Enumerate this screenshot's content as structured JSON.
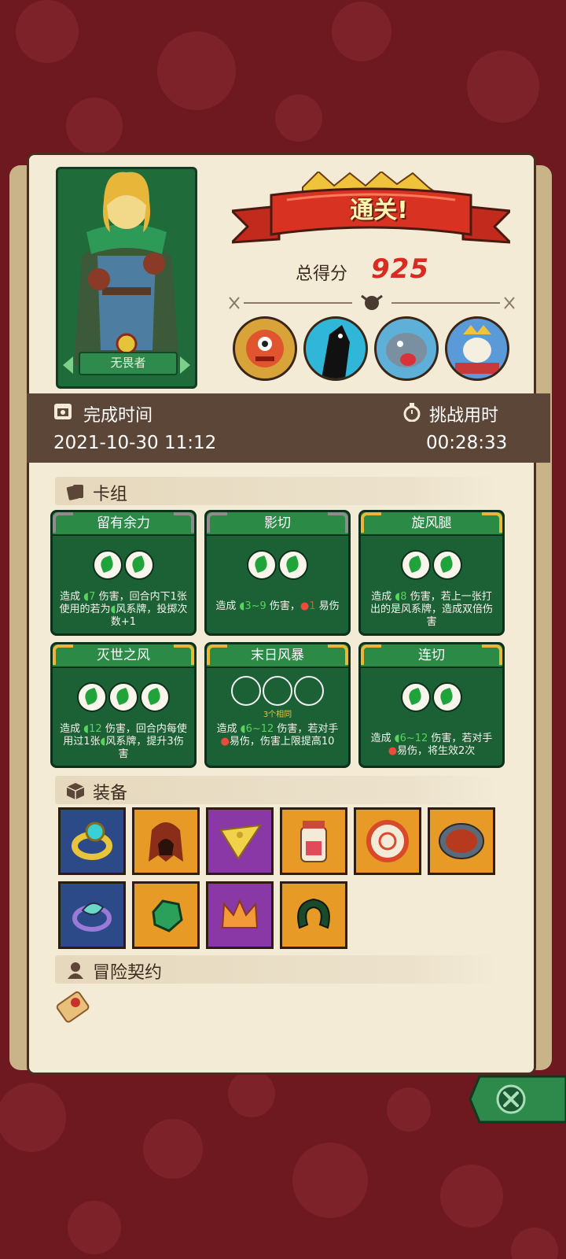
{
  "header": {
    "clear_label": "通关!",
    "score_label": "总得分",
    "score_value": "925"
  },
  "hero": {
    "name": "无畏者"
  },
  "time_bar": {
    "complete_label": "完成时间",
    "complete_value": "2021-10-30 11:12",
    "duration_label": "挑战用时",
    "duration_value": "00:28:33"
  },
  "sections": {
    "deck": "卡组",
    "equipment": "装备",
    "contract": "冒险契约"
  },
  "cards": [
    {
      "title": "留有余力",
      "orbs": 2,
      "d1": "造成 ",
      "v1": "7",
      "d2": " 伤害，回合内下1张使用的若为",
      "d3": "风系牌，投掷次数+1"
    },
    {
      "title": "影切",
      "orbs": 2,
      "d1": "造成 ",
      "v1": "3~9",
      "d2": " 伤害，",
      "v2": "1",
      "d3": " 易伤"
    },
    {
      "title": "旋风腿",
      "orbs": 2,
      "d1": "造成 ",
      "v1": "8",
      "d2": " 伤害，若上一张打出的是风系牌，造成双倍伤害"
    },
    {
      "title": "灭世之风",
      "orbs": 3,
      "d1": "造成 ",
      "v1": "12",
      "d2": " 伤害，回合内每使用过1张",
      "d3": "风系牌，提升3伤害"
    },
    {
      "title": "末日风暴",
      "orbs": 3,
      "same": "3个相同",
      "d1": "造成 ",
      "v1": "6~12",
      "d2": " 伤害，若对手",
      "d3": "易伤，伤害上限提高10"
    },
    {
      "title": "连切",
      "orbs": 2,
      "d1": "造成 ",
      "v1": "6~12",
      "d2": " 伤害，若对手",
      "d3": "易伤，将生效2次"
    }
  ],
  "equipment": [
    {
      "icon": "ring-icon",
      "rarity": "blue"
    },
    {
      "icon": "hood-icon",
      "rarity": "orange"
    },
    {
      "icon": "cheese-icon",
      "rarity": "purple"
    },
    {
      "icon": "jar-icon",
      "rarity": "orange"
    },
    {
      "icon": "coin-icon",
      "rarity": "orange"
    },
    {
      "icon": "plate-icon",
      "rarity": "orange"
    },
    {
      "icon": "leaf-ring-icon",
      "rarity": "blue"
    },
    {
      "icon": "emerald-icon",
      "rarity": "orange"
    },
    {
      "icon": "crown-icon",
      "rarity": "purple"
    },
    {
      "icon": "horseshoe-icon",
      "rarity": "orange"
    }
  ],
  "colors": {
    "background": "#6e1820",
    "panel": "#f3ebd6",
    "card_green": "#1c6136",
    "score_red": "#d82b22"
  }
}
